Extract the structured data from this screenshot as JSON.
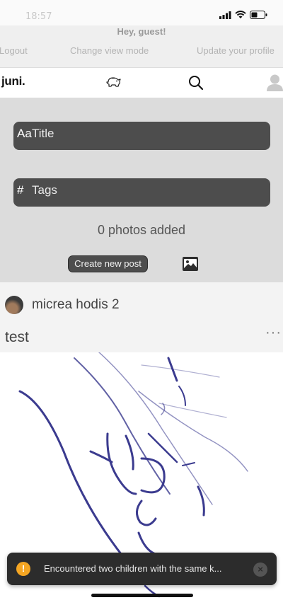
{
  "status_bar": {
    "time": "18:57"
  },
  "guest_bar": {
    "greeting": "Hey, guest!",
    "links": [
      "Logout",
      "Change view mode",
      "Update your profile"
    ]
  },
  "nav": {
    "logo": "juni.",
    "icons": [
      "piggy-bank-icon",
      "search-icon",
      "user-avatar-icon"
    ]
  },
  "composer": {
    "title_prefix": "Aa",
    "title_placeholder": "Title",
    "tags_prefix": "#",
    "tags_placeholder": "Tags",
    "photos_count": "0 photos added",
    "create_button": "Create new post",
    "photo_icon": "image-icon"
  },
  "post": {
    "author": "micrea hodis 2",
    "title": "test",
    "more": "···"
  },
  "toast": {
    "icon": "!",
    "message": "Encountered two children with the same k...",
    "close": "×"
  },
  "colors": {
    "field_bg": "#4d4d4d",
    "composer_bg": "#dcdcdc",
    "toast_bg": "#2c2c2c",
    "warning": "#f5a623",
    "sketch_ink": "#3b3b8f"
  }
}
